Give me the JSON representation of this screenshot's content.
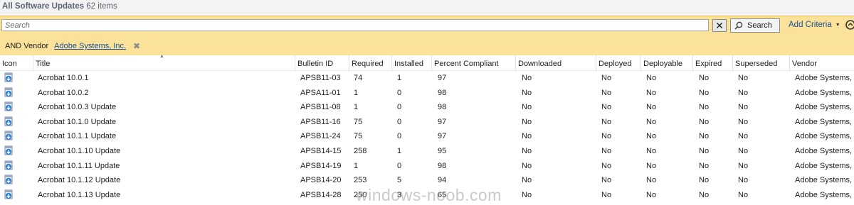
{
  "header": {
    "title": "All Software Updates",
    "count": "62 items"
  },
  "search": {
    "placeholder": "Search",
    "value": "",
    "clear_glyph": "✕",
    "button_label": "Search",
    "add_criteria_label": "Add Criteria",
    "add_criteria_caret": "▼"
  },
  "criteria": {
    "label": "AND Vendor",
    "value": "Adobe Systems, Inc.",
    "remove_glyph": "✖"
  },
  "grid": {
    "sort_glyph": "▲",
    "columns": [
      "Icon",
      "Title",
      "Bulletin ID",
      "Required",
      "Installed",
      "Percent Compliant",
      "Downloaded",
      "Deployed",
      "Deployable",
      "Expired",
      "Superseded",
      "Vendor"
    ],
    "rows": [
      {
        "title": "Acrobat 10.0.1",
        "bulletin": "APSB11-03",
        "required": "74",
        "installed": "1",
        "percent": "97",
        "downloaded": "No",
        "deployed": "No",
        "deployable": "No",
        "expired": "No",
        "superseded": "No",
        "vendor": "Adobe Systems, Inc."
      },
      {
        "title": "Acrobat 10.0.2",
        "bulletin": "APSA11-01",
        "required": "1",
        "installed": "0",
        "percent": "98",
        "downloaded": "No",
        "deployed": "No",
        "deployable": "No",
        "expired": "No",
        "superseded": "No",
        "vendor": "Adobe Systems, Inc."
      },
      {
        "title": "Acrobat 10.0.3 Update",
        "bulletin": "APSB11-08",
        "required": "1",
        "installed": "0",
        "percent": "98",
        "downloaded": "No",
        "deployed": "No",
        "deployable": "No",
        "expired": "No",
        "superseded": "No",
        "vendor": "Adobe Systems, Inc."
      },
      {
        "title": "Acrobat 10.1.0 Update",
        "bulletin": "APSB11-16",
        "required": "75",
        "installed": "0",
        "percent": "97",
        "downloaded": "No",
        "deployed": "No",
        "deployable": "No",
        "expired": "No",
        "superseded": "No",
        "vendor": "Adobe Systems, Inc."
      },
      {
        "title": "Acrobat 10.1.1 Update",
        "bulletin": "APSB11-24",
        "required": "75",
        "installed": "0",
        "percent": "97",
        "downloaded": "No",
        "deployed": "No",
        "deployable": "No",
        "expired": "No",
        "superseded": "No",
        "vendor": "Adobe Systems, Inc."
      },
      {
        "title": "Acrobat 10.1.10 Update",
        "bulletin": "APSB14-15",
        "required": "258",
        "installed": "1",
        "percent": "95",
        "downloaded": "No",
        "deployed": "No",
        "deployable": "No",
        "expired": "No",
        "superseded": "No",
        "vendor": "Adobe Systems, Inc."
      },
      {
        "title": "Acrobat 10.1.11 Update",
        "bulletin": "APSB14-19",
        "required": "1",
        "installed": "0",
        "percent": "98",
        "downloaded": "No",
        "deployed": "No",
        "deployable": "No",
        "expired": "No",
        "superseded": "No",
        "vendor": "Adobe Systems, Inc."
      },
      {
        "title": "Acrobat 10.1.12 Update",
        "bulletin": "APSB14-20",
        "required": "253",
        "installed": "5",
        "percent": "94",
        "downloaded": "No",
        "deployed": "No",
        "deployable": "No",
        "expired": "No",
        "superseded": "No",
        "vendor": "Adobe Systems, Inc."
      },
      {
        "title": "Acrobat 10.1.13 Update",
        "bulletin": "APSB14-28",
        "required": "250",
        "installed": "3",
        "percent": "65",
        "downloaded": "No",
        "deployed": "No",
        "deployable": "No",
        "expired": "No",
        "superseded": "No",
        "vendor": "Adobe Systems, Inc."
      }
    ]
  },
  "watermark": "windows-noob.com",
  "colors": {
    "filter_bg": "#fbe29a",
    "link": "#1e4f95",
    "header_text": "#5a6470"
  }
}
